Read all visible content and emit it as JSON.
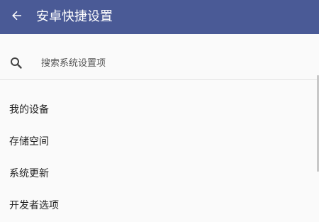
{
  "appbar": {
    "title": "安卓快捷设置",
    "back_icon": "arrow-back-icon",
    "color": "#4a5a96"
  },
  "search": {
    "placeholder": "搜索系统设置项",
    "value": "",
    "icon": "search-icon"
  },
  "list": {
    "items": [
      {
        "label": "我的设备"
      },
      {
        "label": "存储空间"
      },
      {
        "label": "系统更新"
      },
      {
        "label": "开发者选项"
      }
    ]
  }
}
